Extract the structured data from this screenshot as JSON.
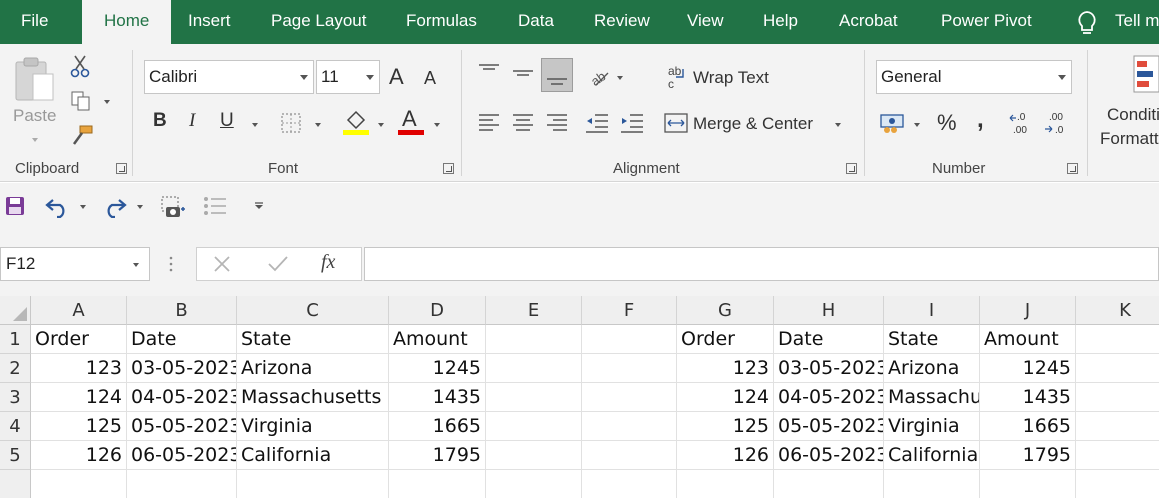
{
  "tabs": [
    "File",
    "Home",
    "Insert",
    "Page Layout",
    "Formulas",
    "Data",
    "Review",
    "View",
    "Help",
    "Acrobat",
    "Power Pivot",
    "Tell m"
  ],
  "ribbon": {
    "clipboard": {
      "paste_label": "Paste",
      "group_label": "Clipboard"
    },
    "font": {
      "font_name": "Calibri",
      "font_size": "11",
      "bold": "B",
      "italic": "I",
      "underline": "U",
      "grow": "A",
      "shrink": "A",
      "group_label": "Font"
    },
    "alignment": {
      "wrap_text": "Wrap Text",
      "merge_center": "Merge & Center",
      "group_label": "Alignment"
    },
    "number": {
      "format": "General",
      "percent": "%",
      "comma": ",",
      "group_label": "Number"
    },
    "styles": {
      "cond_format_line1": "Conditi",
      "cond_format_line2": "Formatt"
    }
  },
  "formula_bar": {
    "name_box": "F12",
    "fx": "fx",
    "formula": ""
  },
  "sheet": {
    "columns": [
      "A",
      "B",
      "C",
      "D",
      "E",
      "F",
      "G",
      "H",
      "I",
      "J",
      "K"
    ],
    "rows": [
      "1",
      "2",
      "3",
      "4",
      "5"
    ],
    "left_table": {
      "headers": [
        "Order",
        "Date",
        "State",
        "Amount"
      ],
      "rows": [
        [
          "123",
          "03-05-2023",
          "Arizona",
          "1245"
        ],
        [
          "124",
          "04-05-2023",
          "Massachusetts",
          "1435"
        ],
        [
          "125",
          "05-05-2023",
          "Virginia",
          "1665"
        ],
        [
          "126",
          "06-05-2023",
          "California",
          "1795"
        ]
      ]
    },
    "right_table": {
      "headers": [
        "Order",
        "Date",
        "State",
        "Amount"
      ],
      "rows": [
        [
          "123",
          "03-05-2023",
          "Arizona",
          "1245"
        ],
        [
          "124",
          "04-05-2023",
          "Massachu",
          "1435"
        ],
        [
          "125",
          "05-05-2023",
          "Virginia",
          "1665"
        ],
        [
          "126",
          "06-05-2023",
          "California",
          "1795"
        ]
      ]
    }
  },
  "colors": {
    "brand": "#217346",
    "font_highlight": "#ffff00",
    "font_color": "#e00000",
    "qat_blue": "#2b579a"
  }
}
